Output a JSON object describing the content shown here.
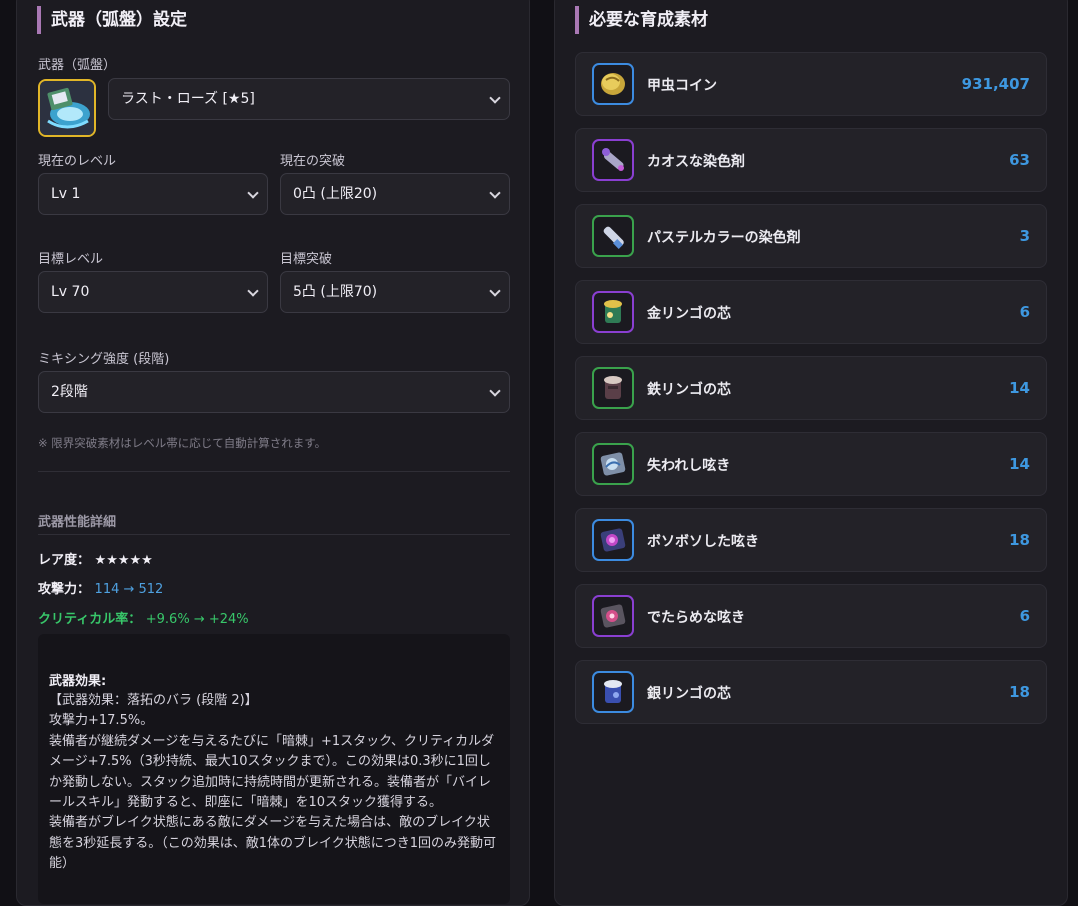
{
  "weapon_settings": {
    "section_title": "武器（弧盤）設定",
    "weapon_label": "武器（弧盤）",
    "weapon_selected": "ラスト・ローズ [★5]",
    "current_level_label": "現在のレベル",
    "current_level_value": "Lv 1",
    "current_breakthrough_label": "現在の突破",
    "current_breakthrough_value": "0凸 (上限20)",
    "target_level_label": "目標レベル",
    "target_level_value": "Lv 70",
    "target_breakthrough_label": "目標突破",
    "target_breakthrough_value": "5凸 (上限70)",
    "mixing_label": "ミキシング強度 (段階)",
    "mixing_value": "2段階",
    "note": "※ 限界突破素材はレベル帯に応じて自動計算されます。"
  },
  "weapon_details": {
    "heading": "武器性能詳細",
    "rarity_label": "レア度：",
    "rarity_value": "★★★★★",
    "attack_label": "攻撃力：",
    "attack_value": "114 → 512",
    "crit_label": "クリティカル率：",
    "crit_value": "+9.6% → +24%",
    "effect_title": "武器効果:",
    "effect_text": "【武器効果：落拓のバラ (段階 2)】\n攻撃力+17.5%。\n装備者が継続ダメージを与えるたびに「暗棘」+1スタック、クリティカルダメージ+7.5%（3秒持続、最大10スタックまで）。この効果は0.3秒に1回しか発動しない。スタック追加時に持続時間が更新される。装備者が「バイレールスキル」発動すると、即座に「暗棘」を10スタック獲得する。\n装備者がブレイク状態にある敵にダメージを与えた場合は、敵のブレイク状態を3秒延長する。（この効果は、敵1体のブレイク状態につき1回のみ発動可能）"
  },
  "materials": {
    "section_title": "必要な育成素材",
    "items": [
      {
        "name": "甲虫コイン",
        "count": "931,407",
        "icon": "beetle-coin-icon",
        "frame": "blue"
      },
      {
        "name": "カオスな染色剤",
        "count": "63",
        "icon": "chaos-dye-icon",
        "frame": "purple"
      },
      {
        "name": "パステルカラーの染色剤",
        "count": "3",
        "icon": "pastel-dye-icon",
        "frame": "green"
      },
      {
        "name": "金リンゴの芯",
        "count": "6",
        "icon": "gold-apple-core-icon",
        "frame": "purple"
      },
      {
        "name": "鉄リンゴの芯",
        "count": "14",
        "icon": "iron-apple-core-icon",
        "frame": "green"
      },
      {
        "name": "失われし呟き",
        "count": "14",
        "icon": "lost-whisper-icon",
        "frame": "green"
      },
      {
        "name": "ボソボソした呟き",
        "count": "18",
        "icon": "mumbled-whisper-icon",
        "frame": "blue"
      },
      {
        "name": "でたらめな呟き",
        "count": "6",
        "icon": "nonsense-whisper-icon",
        "frame": "purple"
      },
      {
        "name": "銀リンゴの芯",
        "count": "18",
        "icon": "silver-apple-core-icon",
        "frame": "blue"
      }
    ]
  }
}
